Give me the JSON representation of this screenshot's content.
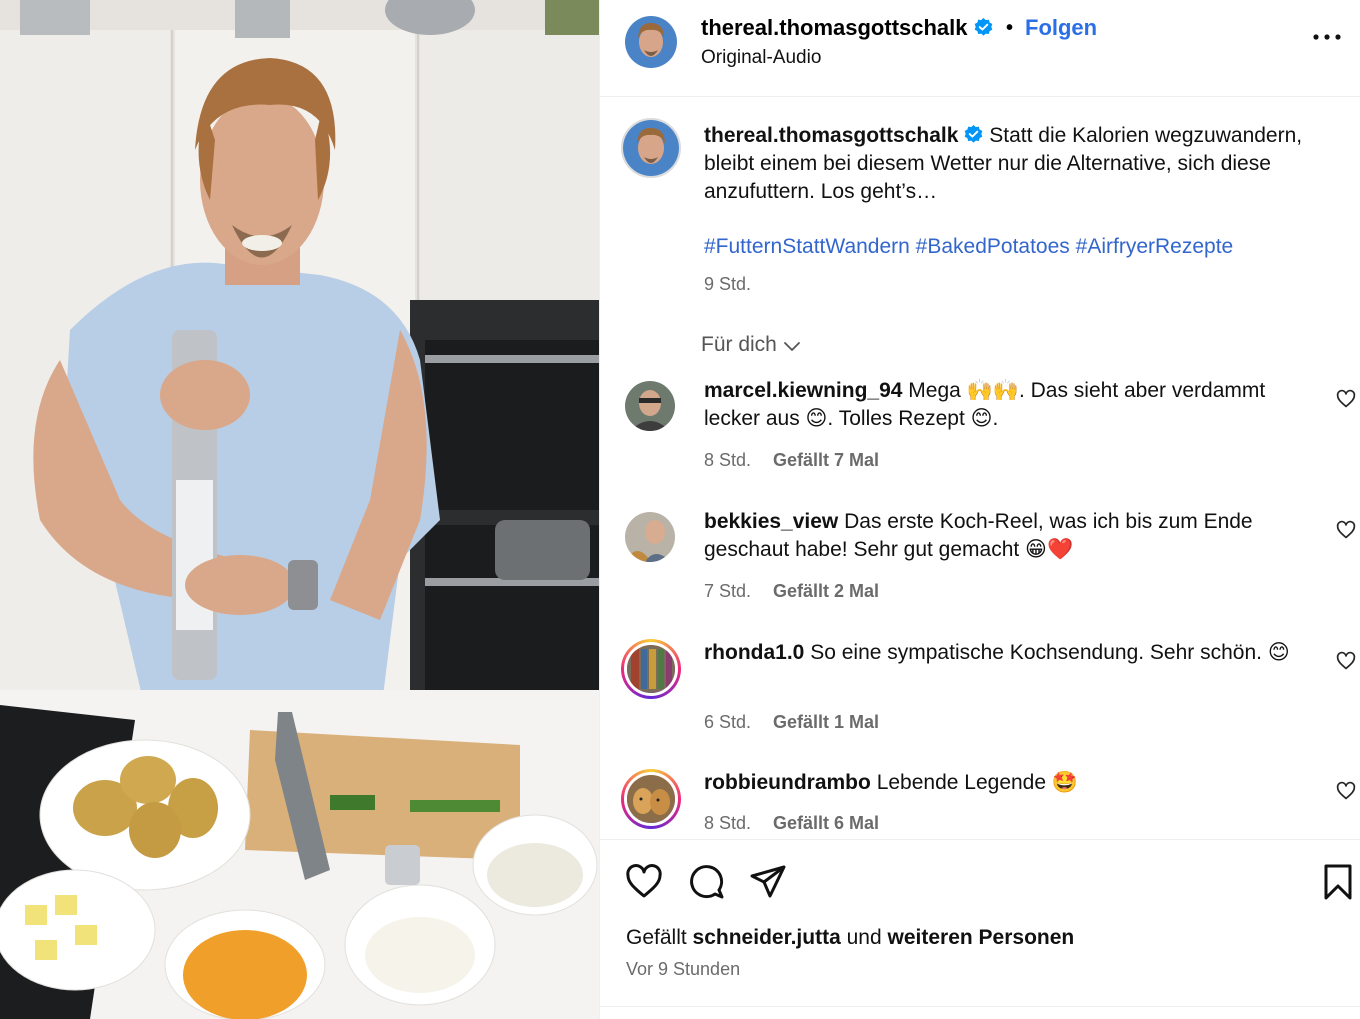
{
  "post": {
    "username": "thereal.thomasgottschalk",
    "follow_label": "Folgen",
    "separator": "•",
    "audio": "Original-Audio",
    "more": "•••"
  },
  "caption": {
    "username": "thereal.thomasgottschalk",
    "text": "Statt die Kalorien wegzuwandern, bleibt einem bei diesem Wetter nur die Alternative, sich diese anzufuttern. Los geht’s…",
    "hashtags": [
      "#FutternStattWandern",
      "#BakedPotatoes",
      "#AirfryerRezepte"
    ],
    "time": "9 Std."
  },
  "sort": {
    "label": "Für dich"
  },
  "comments": [
    {
      "username": "marcel.kiewning_94",
      "text": "Mega 🙌🙌. Das sieht aber verdammt lecker aus 😊. Tolles Rezept 😊.",
      "time": "8 Std.",
      "likes": "Gefällt 7 Mal"
    },
    {
      "username": "bekkies_view",
      "text": "Das erste Koch-Reel, was ich bis zum Ende geschaut habe! Sehr gut gemacht 😁❤️",
      "time": "7 Std.",
      "likes": "Gefällt 2 Mal"
    },
    {
      "username": "rhonda1.0",
      "text": "So eine sympatische Kochsendung. Sehr schön. 😊",
      "time": "6 Std.",
      "likes": "Gefällt 1 Mal"
    },
    {
      "username": "robbieundrambo",
      "text": "Lebende Legende 🤩",
      "time": "8 Std.",
      "likes": "Gefällt 6 Mal"
    }
  ],
  "likes": {
    "prefix": "Gefällt",
    "user": "schneider.jutta",
    "middle": "und",
    "others": "weiteren Personen"
  },
  "posted": "Vor 9 Stunden",
  "colors": {
    "link": "#2b6fe6",
    "verified": "#0095f6",
    "muted": "#6b6b6b"
  },
  "icons": [
    "verified-icon",
    "more-icon",
    "chevron-down-icon",
    "heart-icon",
    "comment-icon",
    "share-icon",
    "bookmark-icon"
  ]
}
